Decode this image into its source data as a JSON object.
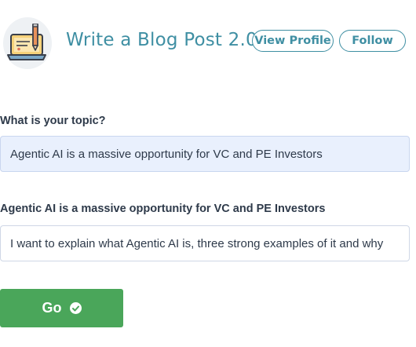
{
  "header": {
    "title": "Write a Blog Post 2.0",
    "view_profile_label": "View Profile",
    "follow_label": "Follow",
    "logo_icon": "laptop-pencil-icon"
  },
  "form": {
    "topic_label": "What is your topic?",
    "topic_value": "Agentic AI is a massive opportunity for VC and PE Investors",
    "details_label": "Agentic AI is a massive opportunity for VC and PE Investors",
    "details_value": "I want to explain what Agentic AI is, three strong examples of it and why"
  },
  "actions": {
    "go_label": "Go",
    "go_icon": "check-circle-icon"
  },
  "colors": {
    "accent": "#3f8fa3",
    "go_button": "#4aa65a",
    "topic_field_bg": "#e9f0fd"
  }
}
